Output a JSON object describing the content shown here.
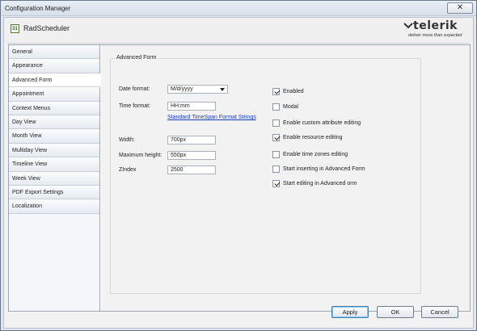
{
  "window": {
    "title": "Configuration Manager",
    "close_glyph": "✕"
  },
  "header": {
    "app_title": "RadScheduler",
    "app_icon": "calendar-icon",
    "logo": {
      "word": "telerik",
      "tagline": "deliver more than expected"
    }
  },
  "sidebar": {
    "items": [
      {
        "label": "General",
        "active": false
      },
      {
        "label": "Appearance",
        "active": false
      },
      {
        "label": "Advanced Form",
        "active": true
      },
      {
        "label": "Appointment",
        "active": false
      },
      {
        "label": "Context Menus",
        "active": false
      },
      {
        "label": "Day View",
        "active": false
      },
      {
        "label": "Month View",
        "active": false
      },
      {
        "label": "Multiday View",
        "active": false
      },
      {
        "label": "Timeline View",
        "active": false
      },
      {
        "label": "Week View",
        "active": false
      },
      {
        "label": "PDF Export Settings",
        "active": false
      },
      {
        "label": "Localization",
        "active": false
      }
    ]
  },
  "form": {
    "group_title": "Advanced Form",
    "date_format": {
      "label": "Date format:",
      "value": "M/d/yyyy"
    },
    "time_format": {
      "label": "Time format:",
      "value": "HH:mm"
    },
    "format_link": "Standard TimeSpan Format Strings",
    "width": {
      "label": "Width:",
      "value": "700px"
    },
    "max_height": {
      "label": "Maximum height:",
      "value": "550px"
    },
    "zindex": {
      "label": "ZIndex",
      "value": "2500"
    },
    "checkboxes": [
      {
        "label": "Enabled",
        "checked": true
      },
      {
        "label": "Modal",
        "checked": false
      },
      {
        "label": "Enable custom attribute editing",
        "checked": false
      },
      {
        "label": "Enable resource editing",
        "checked": true
      },
      {
        "label": "Enable time zones editing",
        "checked": false
      },
      {
        "label": "Start inserting in Advanced Form",
        "checked": false
      },
      {
        "label": "Start editing in Advanced orm",
        "checked": true
      }
    ]
  },
  "buttons": {
    "apply": "Apply",
    "ok": "OK",
    "cancel": "Cancel"
  },
  "colors": {
    "link": "#1a3fb5",
    "default_button_border": "#3c7fb1"
  }
}
